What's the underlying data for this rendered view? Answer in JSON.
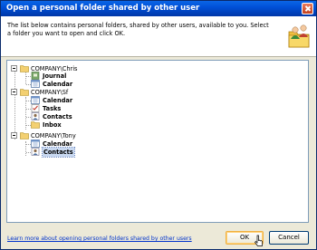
{
  "dialog": {
    "title": "Open a personal folder shared by other user",
    "description": "The list below contains personal folders, shared by other users, available to you. Select a folder you want to open and click OK.",
    "learn_more": "Learn more about opening personal folders shared by other users",
    "ok_label": "OK",
    "cancel_label": "Cancel"
  },
  "tree": {
    "users": [
      {
        "name": "COMPANY\\Chris",
        "folders": [
          {
            "label": "Journal",
            "icon": "journal-icon"
          },
          {
            "label": "Calendar",
            "icon": "calendar-icon"
          }
        ]
      },
      {
        "name": "COMPANY\\Sf",
        "folders": [
          {
            "label": "Calendar",
            "icon": "calendar-icon"
          },
          {
            "label": "Tasks",
            "icon": "tasks-icon"
          },
          {
            "label": "Contacts",
            "icon": "contacts-icon"
          },
          {
            "label": "Inbox",
            "icon": "folder-icon"
          }
        ]
      },
      {
        "name": "COMPANY\\Tony",
        "folders": [
          {
            "label": "Calendar",
            "icon": "calendar-icon"
          },
          {
            "label": "Contacts",
            "icon": "contacts-icon",
            "selected": true
          }
        ]
      }
    ]
  },
  "colors": {
    "title_bar": "#0050d8",
    "dialog_bg": "#ece9d8",
    "link": "#0033cc",
    "selection": "#c8d8f0"
  }
}
